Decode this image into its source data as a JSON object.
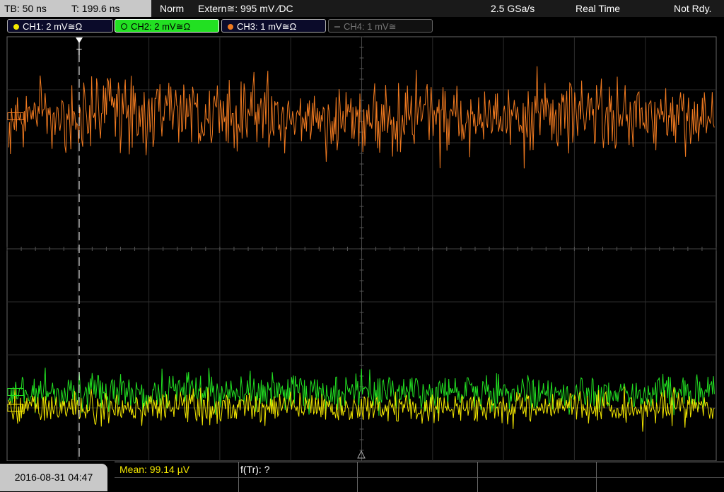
{
  "status": {
    "timebase": "TB: 50 ns",
    "trigger_time": "T: 199.6 ns",
    "trigger_mode": "Norm",
    "trigger_source": "Extern≅: 995 mV ∕DC",
    "sample_rate": "2.5 GSa/s",
    "acq_mode": "Real Time",
    "state": "Not Rdy."
  },
  "channels": [
    {
      "label": "CH1: 2 mV≅Ω",
      "color": "#f2e600",
      "active": true
    },
    {
      "label": "CH2: 2 mV≅Ω",
      "color": "#22e022",
      "active": true,
      "selected": true
    },
    {
      "label": "CH3: 1 mV≅Ω",
      "color": "#f07a20",
      "active": true
    },
    {
      "label": "CH4: 1 mV≅",
      "color": "#777777",
      "active": false
    }
  ],
  "waveforms": {
    "ch3_level_div": 2.5,
    "ch3_noise_div": 0.5,
    "ch2_level_div": -2.7,
    "ch2_noise_div": 0.25,
    "ch1_level_div": -3.0,
    "ch1_noise_div": 0.22
  },
  "grid": {
    "h_divs": 10,
    "v_divs": 8
  },
  "trigger_marker": "T",
  "datetime": "2016-08-31 04:47",
  "measurements": {
    "mean": "Mean: 99.14 µV",
    "freq": "f(Tr): ?"
  }
}
